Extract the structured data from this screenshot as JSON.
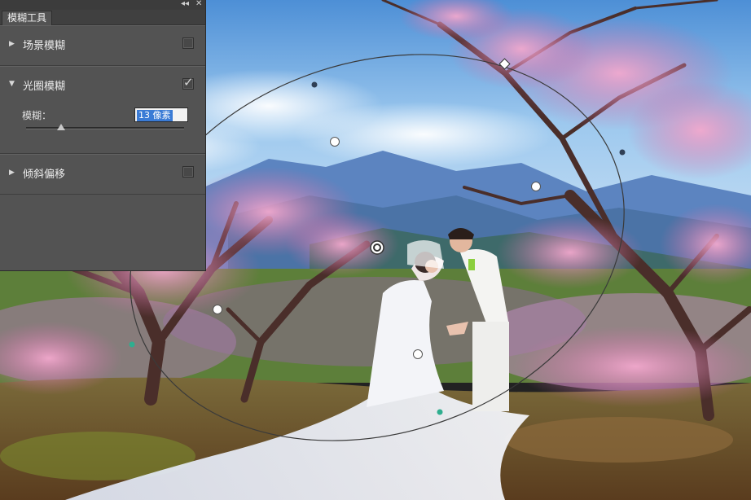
{
  "panel": {
    "title": "模糊工具",
    "collapse_glyph": "◂◂",
    "close_glyph": "✕",
    "sections": [
      {
        "label": "场景模糊",
        "expanded": false,
        "checked": false
      },
      {
        "label": "光圈模糊",
        "expanded": true,
        "checked": true
      },
      {
        "label": "倾斜偏移",
        "expanded": false,
        "checked": false
      }
    ],
    "iris_blur": {
      "param_label": "模糊：",
      "value_text": "13 像素",
      "slider_value_fraction": 0.22
    }
  },
  "icons": {
    "collapsed": "triangle-right-icon",
    "expanded": "triangle-down-icon",
    "check": "checkmark-icon"
  },
  "colors": {
    "panel_bg": "#535353",
    "selection": "#3a7bd5",
    "sky": "#6fa6dc",
    "blossom": "#e48ab6"
  }
}
